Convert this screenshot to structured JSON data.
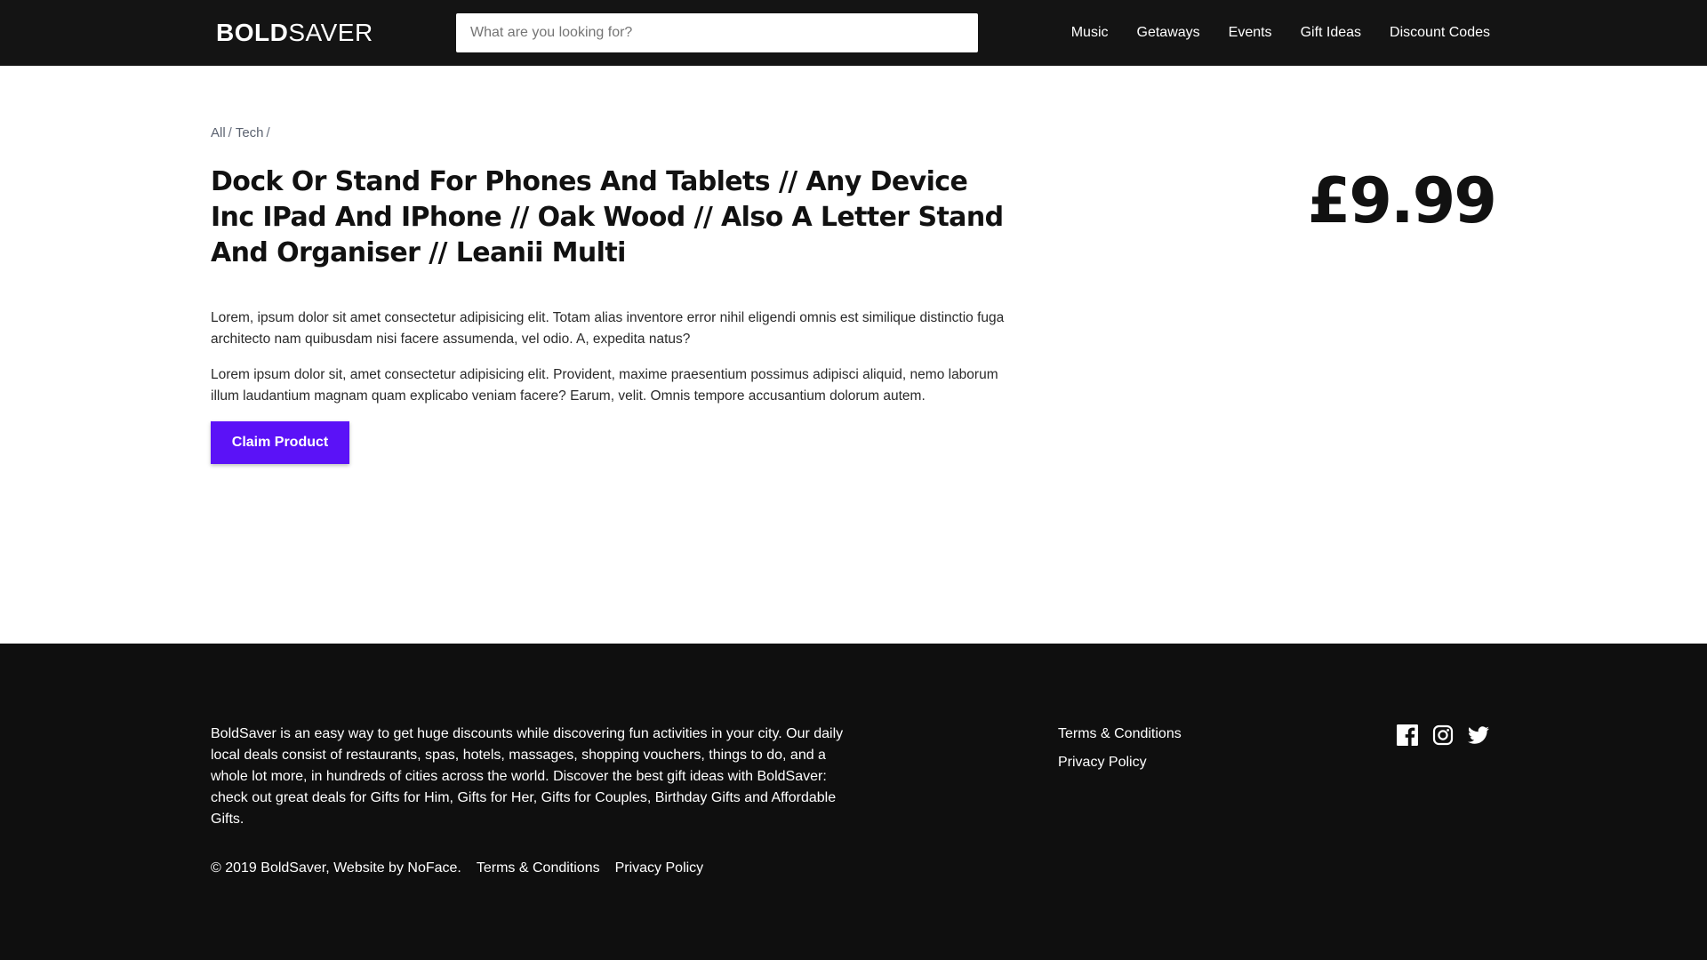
{
  "header": {
    "logo_bold": "BOLD",
    "logo_light": "SAVER",
    "search_placeholder": "What are you looking for?",
    "nav": [
      "Music",
      "Getaways",
      "Events",
      "Gift Ideas",
      "Discount Codes"
    ]
  },
  "breadcrumb": {
    "items": [
      "All",
      "Tech"
    ],
    "separator": "/"
  },
  "product": {
    "title": "Dock Or Stand For Phones And Tablets // Any Device Inc IPad And IPhone // Oak Wood // Also A Letter Stand And Organiser // Leanii Multi",
    "price": "£9.99",
    "description": [
      "Lorem, ipsum dolor sit amet consectetur adipisicing elit. Totam alias inventore error nihil eligendi omnis est similique distinctio fuga architecto nam quibusdam nisi facere assumenda, vel odio. A, expedita natus?",
      "Lorem ipsum dolor sit, amet consectetur adipisicing elit. Provident, maxime praesentium possimus adipisci aliquid, nemo laborum illum laudantium magnam quam explicabo veniam facere? Earum, velit. Omnis tempore accusantium dolorum autem."
    ],
    "claim_label": "Claim Product"
  },
  "footer": {
    "about": "BoldSaver is an easy way to get huge discounts while discovering fun activities in your city. Our daily local deals consist of restaurants, spas, hotels, massages, shopping vouchers, things to do, and a whole lot more, in hundreds of cities across the world. Discover the best gift ideas with BoldSaver: check out great deals for Gifts for Him, Gifts for Her, Gifts for Couples, Birthday Gifts and Affordable Gifts.",
    "copyright": "© 2019 BoldSaver, Website by NoFace.",
    "bottom_links": [
      "Terms & Conditions",
      "Privacy Policy"
    ],
    "links": [
      "Terms & Conditions",
      "Privacy Policy"
    ],
    "social_icons": [
      "facebook-icon",
      "instagram-icon",
      "twitter-icon"
    ]
  },
  "colors": {
    "header_bg": "#141414",
    "footer_bg": "#0f0f0f",
    "accent": "#5b12f7"
  }
}
